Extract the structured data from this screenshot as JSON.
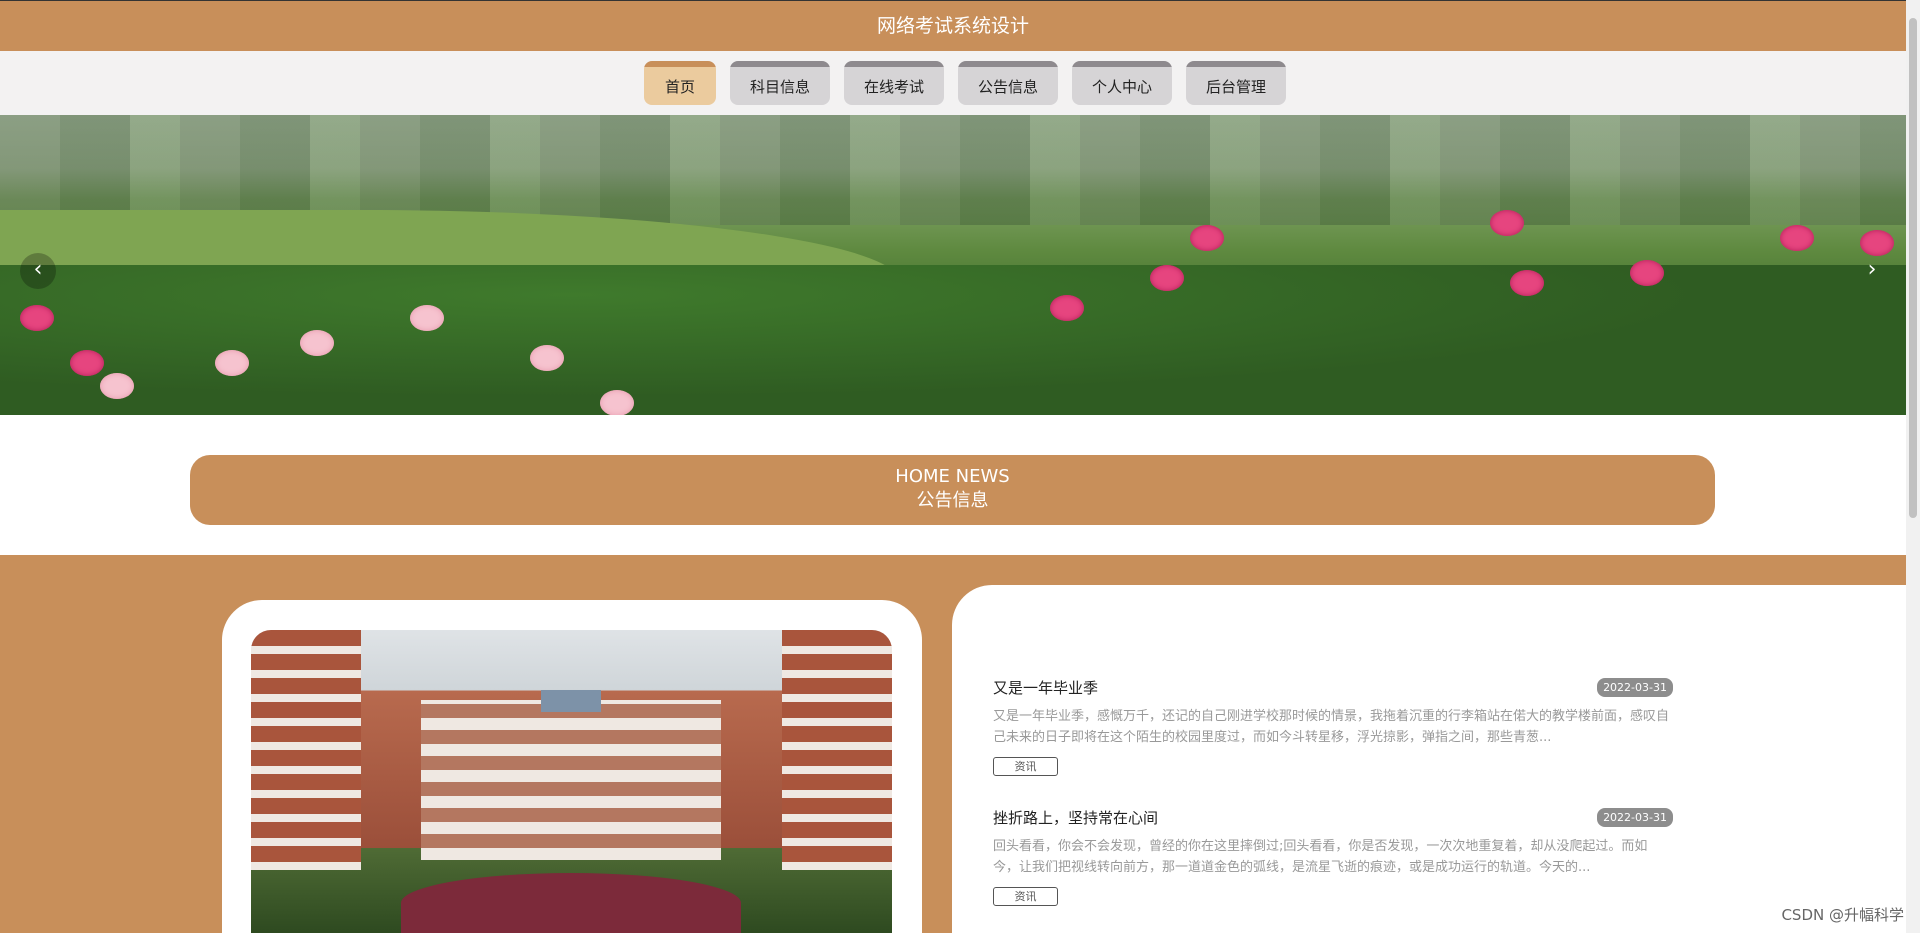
{
  "header": {
    "title": "网络考试系统设计"
  },
  "nav": {
    "items": [
      {
        "label": "首页"
      },
      {
        "label": "科目信息"
      },
      {
        "label": "在线考试"
      },
      {
        "label": "公告信息"
      },
      {
        "label": "个人中心"
      },
      {
        "label": "后台管理"
      }
    ]
  },
  "banner": {
    "prev": "‹",
    "next": "›"
  },
  "section": {
    "title_en": "HOME NEWS",
    "title_cn": "公告信息"
  },
  "news": [
    {
      "title": "又是一年毕业季",
      "date": "2022-03-31",
      "desc": "又是一年毕业季，感慨万千，还记的自己刚进学校那时候的情景，我拖着沉重的行李箱站在偌大的教学楼前面，感叹自己未来的日子即将在这个陌生的校园里度过，而如今斗转星移，浮光掠影，弹指之间，那些青葱...",
      "tag": "资讯"
    },
    {
      "title": "挫折路上，坚持常在心间",
      "date": "2022-03-31",
      "desc": "回头看看，你会不会发现，曾经的你在这里摔倒过;回头看看，你是否发现，一次次地重复着，却从没爬起过。而如今，让我们把视线转向前方，那一道道金色的弧线，是流星飞逝的痕迹，或是成功运行的轨道。今天的...",
      "tag": "资讯"
    }
  ],
  "watermark": "CSDN @升幅科学"
}
